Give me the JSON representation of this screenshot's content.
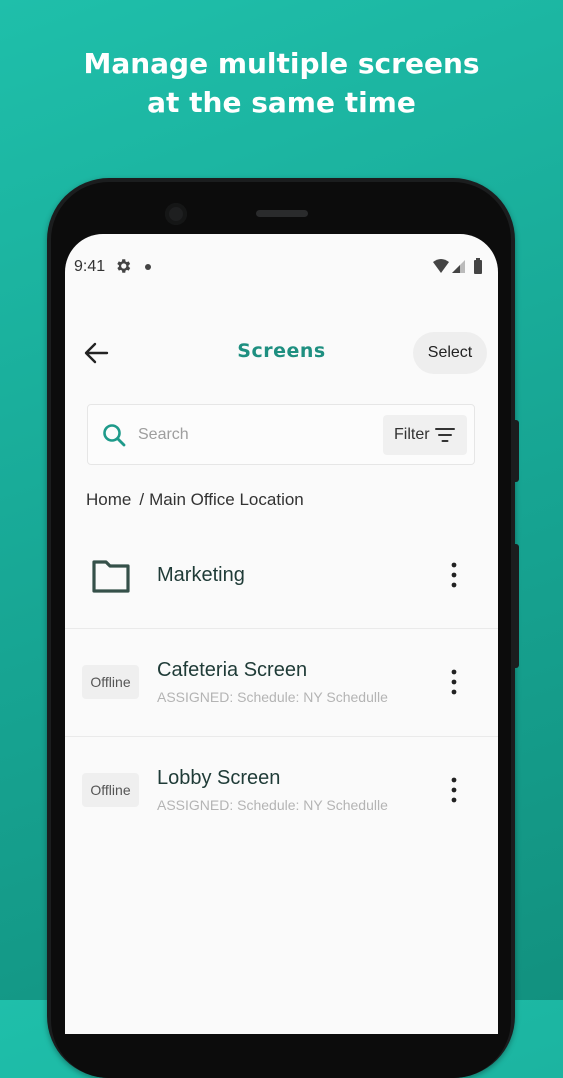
{
  "headline": {
    "line1": "Manage multiple screens",
    "line2": "at the same time"
  },
  "status_bar": {
    "time": "9:41"
  },
  "header": {
    "title": "Screens",
    "select_label": "Select"
  },
  "search": {
    "placeholder": "Search",
    "value": "",
    "filter_label": "Filter"
  },
  "breadcrumb": {
    "home": "Home",
    "separator": "/",
    "current": "Main Office Location"
  },
  "folders": [
    {
      "name": "Marketing"
    }
  ],
  "screens": [
    {
      "name": "Cafeteria Screen",
      "status": "Offline",
      "assignment": "ASSIGNED: Schedule: NY Schedulle"
    },
    {
      "name": "Lobby Screen",
      "status": "Offline",
      "assignment": "ASSIGNED: Schedule: NY Schedulle"
    }
  ],
  "colors": {
    "background": "#1fbfaa",
    "accent": "#1e8f80",
    "text_dark": "#1f3b37",
    "text_muted": "#b4b4b4"
  },
  "icons": {
    "back": "arrow-left-icon",
    "search": "search-icon",
    "filter": "filter-icon",
    "folder": "folder-icon",
    "more": "kebab-menu-icon",
    "settings": "gear-icon",
    "wifi": "wifi-icon",
    "signal": "signal-icon",
    "battery": "battery-icon"
  }
}
